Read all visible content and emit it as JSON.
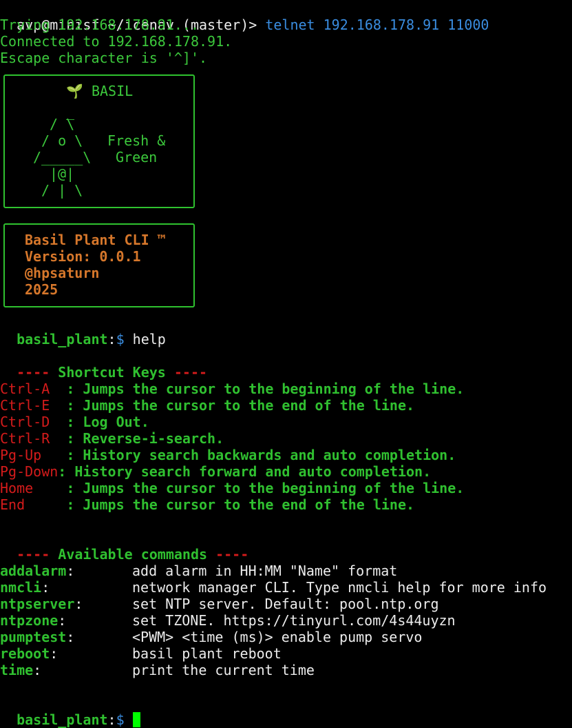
{
  "session": {
    "shell_prompt": "avp@minisf ~/icenav (master)> ",
    "shell_cmd": "telnet",
    "shell_args": " 192.168.178.91 11000",
    "trying": "Trying 192.168.178.91...",
    "connected": "Connected to 192.168.178.91.",
    "escape": "Escape character is '^]'."
  },
  "banner": {
    "title": "🌱 BASIL",
    "art": [
      " _",
      "/ \\",
      "/ o \\",
      "/_____\\",
      "|@|",
      "/ | \\"
    ],
    "tagline_1": "Fresh &",
    "tagline_2": "Green"
  },
  "info": {
    "name": "Basil Plant CLI ™",
    "version": "Version: 0.0.1",
    "author": "@hpsaturn",
    "year": "2025"
  },
  "prompt": {
    "name": "basil_plant",
    "sep": ":",
    "dollar": "$",
    "first_cmd": " help"
  },
  "shortcuts": {
    "dash_left": "----",
    "heading": " Shortcut Keys ",
    "dash_right": "----",
    "items": [
      {
        "key": "Ctrl-A  ",
        "desc": ": Jumps the cursor to the beginning of the line."
      },
      {
        "key": "Ctrl-E  ",
        "desc": ": Jumps the cursor to the end of the line."
      },
      {
        "key": "Ctrl-D  ",
        "desc": ": Log Out."
      },
      {
        "key": "Ctrl-R  ",
        "desc": ": Reverse-i-search."
      },
      {
        "key": "Pg-Up   ",
        "desc": ": History search backwards and auto completion."
      },
      {
        "key": "Pg-Down",
        "desc": ": History search forward and auto completion."
      },
      {
        "key": "Home    ",
        "desc": ": Jumps the cursor to the beginning of the line."
      },
      {
        "key": "End     ",
        "desc": ": Jumps the cursor to the end of the line."
      }
    ]
  },
  "commands": {
    "dash_left": "----",
    "heading": " Available commands ",
    "dash_right": "----",
    "items": [
      {
        "name": "addalarm",
        "desc": "add alarm in HH:MM \"Name\" format"
      },
      {
        "name": "nmcli",
        "desc": "network manager CLI. Type nmcli help for more info"
      },
      {
        "name": "ntpserver",
        "desc": "set NTP server. Default: pool.ntp.org"
      },
      {
        "name": "ntpzone",
        "desc": "set TZONE. https://tinyurl.com/4s44uyzn"
      },
      {
        "name": "pumptest",
        "desc": "<PWM> <time (ms)> enable pump servo"
      },
      {
        "name": "reboot",
        "desc": "basil plant reboot"
      },
      {
        "name": "time",
        "desc": "print the current time"
      }
    ],
    "colon": ":"
  },
  "colors": {
    "green": "#3cc83c",
    "red": "#d41b1b",
    "orange": "#d6772b",
    "blue": "#3a8de0",
    "cursor": "#00ff00"
  }
}
